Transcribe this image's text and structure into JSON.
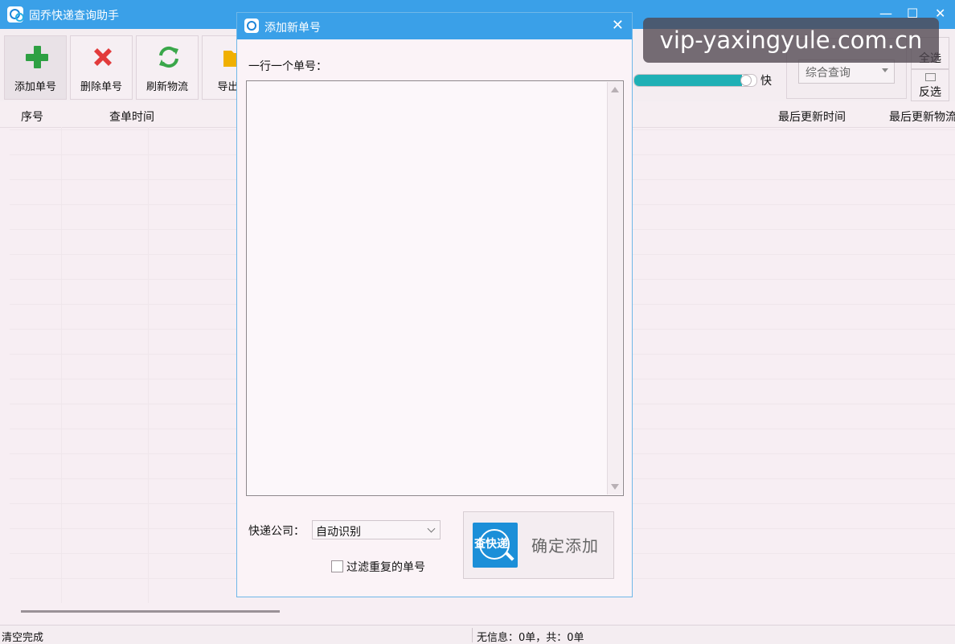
{
  "window": {
    "title": "固乔快递查询助手",
    "controls": {
      "minimize": "—",
      "maximize": "☐",
      "close": "✕"
    }
  },
  "toolbar": {
    "buttons": [
      {
        "label": "添加单号",
        "icon": "add-plus-icon",
        "color": "#2ea043"
      },
      {
        "label": "删除单号",
        "icon": "delete-x-icon",
        "color": "#e23b3b"
      },
      {
        "label": "刷新物流",
        "icon": "refresh-icon",
        "color": "#3aa74a"
      },
      {
        "label": "导出表",
        "icon": "folder-export-icon",
        "color": "#f0b000"
      }
    ],
    "speed_label": "快",
    "speed_fraction": 0.88,
    "query_mode": "综合查询",
    "select_all": "全选",
    "invert_select": "反选"
  },
  "grid": {
    "columns": [
      "序号",
      "查单时间",
      "最后更新时间",
      "最后更新物流"
    ]
  },
  "status": {
    "left": "清空完成",
    "right": "无信息：0单，共：0单"
  },
  "watermark": "vip-yaxingyule.com.cn",
  "dialog": {
    "title": "添加新单号",
    "close": "✕",
    "input_label": "一行一个单号：",
    "textarea_value": "",
    "company_label": "快递公司：",
    "company_value": "自动识别",
    "filter_duplicates_label": "过滤重复的单号",
    "filter_duplicates_checked": false,
    "confirm_icon_text": "查快递",
    "confirm_label": "确定添加"
  },
  "colors": {
    "titlebar": "#3aa0e8",
    "speed_fill": "#1fb0b5",
    "background": "#f7eef3"
  }
}
